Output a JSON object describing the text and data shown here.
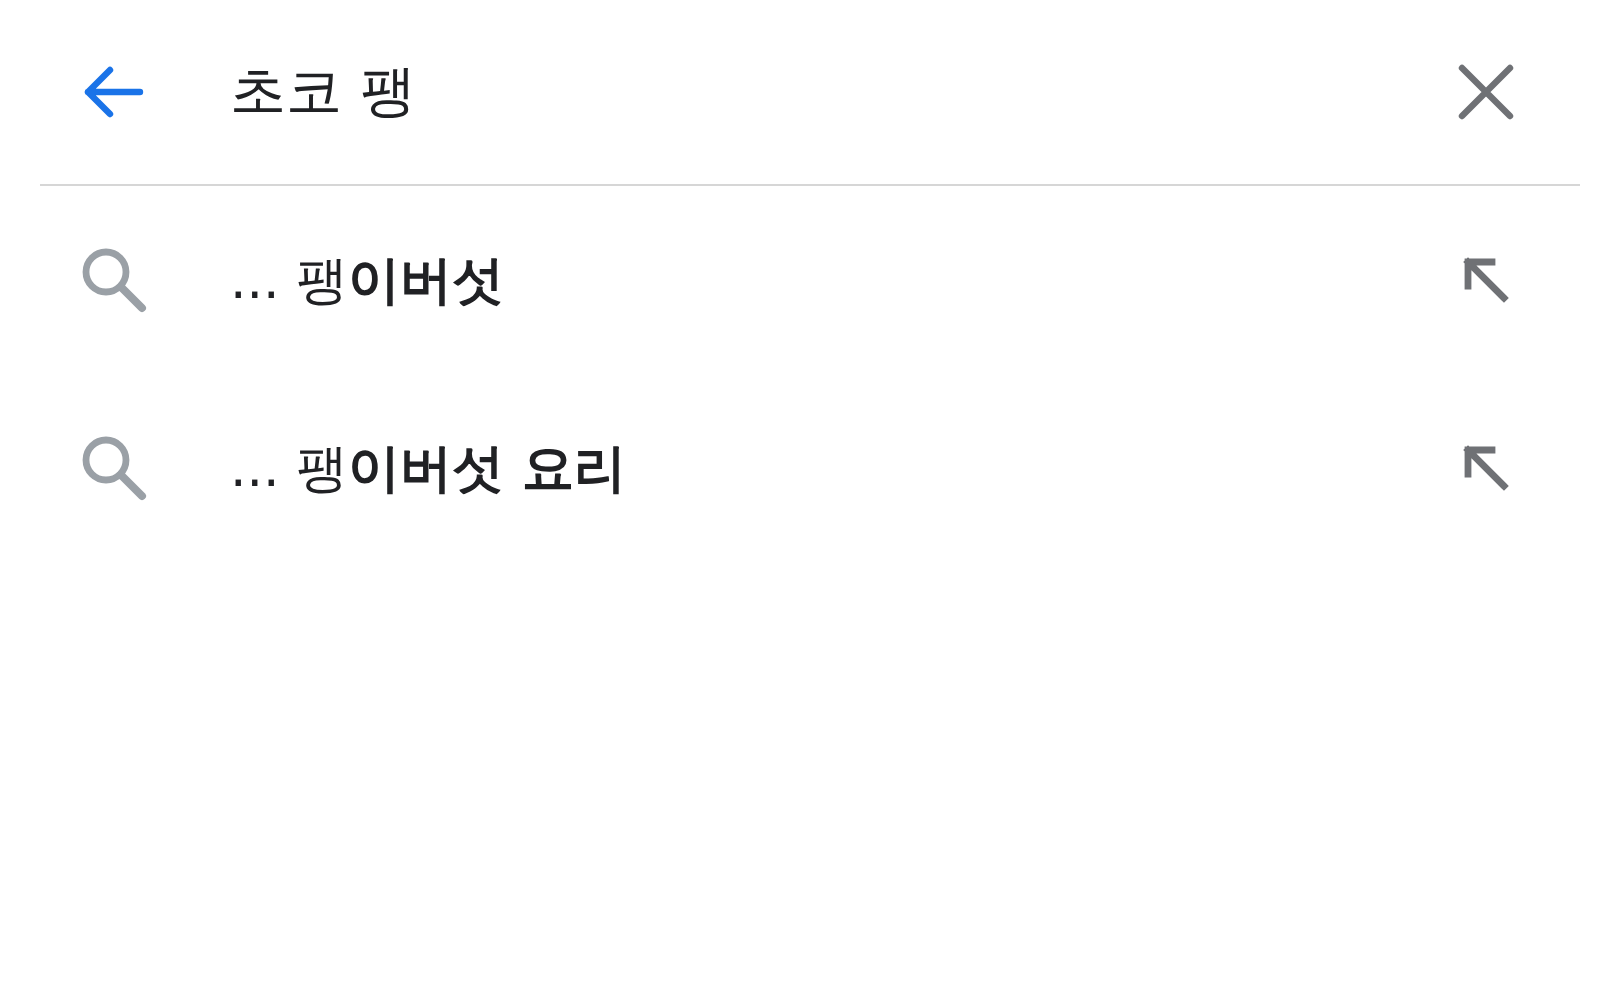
{
  "search": {
    "value": "초코 팽"
  },
  "suggestions": [
    {
      "text": "... 팽**이버섯**"
    },
    {
      "text": "... 팽**이버섯 요리**"
    }
  ]
}
